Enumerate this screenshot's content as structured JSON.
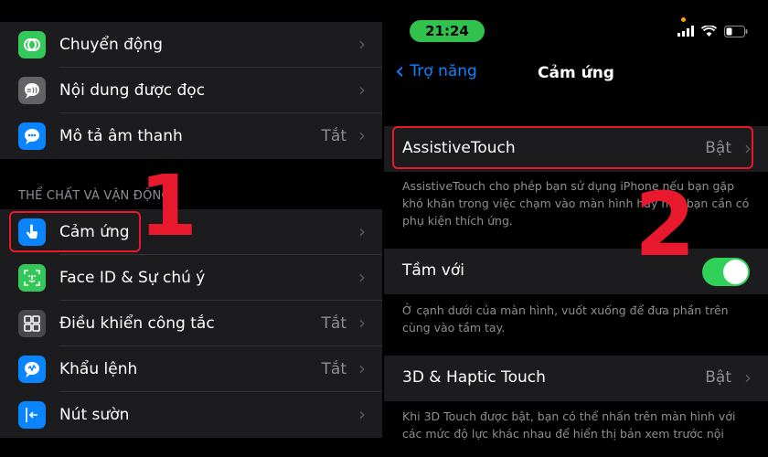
{
  "left": {
    "items_top": [
      {
        "label": "Chuyển động",
        "value": "",
        "icon": "motion-icon",
        "color": "#34c759"
      },
      {
        "label": "Nội dung được đọc",
        "value": "",
        "icon": "spoken-content-icon",
        "color": "#636366"
      },
      {
        "label": "Mô tả âm thanh",
        "value": "Tắt",
        "icon": "audio-description-icon",
        "color": "#0a84ff"
      }
    ],
    "section_header": "THỂ CHẤT VÀ VẬN ĐỘNG",
    "items_bottom": [
      {
        "label": "Cảm ứng",
        "value": "",
        "icon": "touch-icon",
        "color": "#0a84ff"
      },
      {
        "label": "Face ID & Sự chú ý",
        "value": "",
        "icon": "face-id-icon",
        "color": "#34c759"
      },
      {
        "label": "Điều khiển công tắc",
        "value": "Tắt",
        "icon": "switch-control-icon",
        "color": "#48484a"
      },
      {
        "label": "Khẩu lệnh",
        "value": "Tắt",
        "icon": "voice-control-icon",
        "color": "#0a84ff"
      },
      {
        "label": "Nút sườn",
        "value": "",
        "icon": "side-button-icon",
        "color": "#0a84ff"
      }
    ],
    "step_number": "1"
  },
  "right": {
    "time": "21:24",
    "back_label": "Trợ năng",
    "title": "Cảm ứng",
    "assistive_label": "AssistiveTouch",
    "assistive_value": "Bật",
    "assistive_desc": "AssistiveTouch cho phép bạn sử dụng iPhone nếu bạn gặp khó khăn trong việc chạm vào màn hình hay nếu bạn cần có phụ kiện thích ứng.",
    "reach_label": "Tầm với",
    "reach_on": true,
    "reach_desc": "Ở cạnh dưới của màn hình, vuốt xuống để đưa phần trên cùng vào tầm tay.",
    "haptic_label": "3D & Haptic Touch",
    "haptic_value": "Bật",
    "haptic_desc": "Khi 3D Touch được bật, bạn có thể nhấn trên màn hình với các mức độ lực khác nhau để hiển thị bản xem trước nội",
    "step_number": "2"
  },
  "colors": {
    "highlight": "#e8192c",
    "accent": "#0a84ff",
    "toggle_on": "#30d158"
  }
}
